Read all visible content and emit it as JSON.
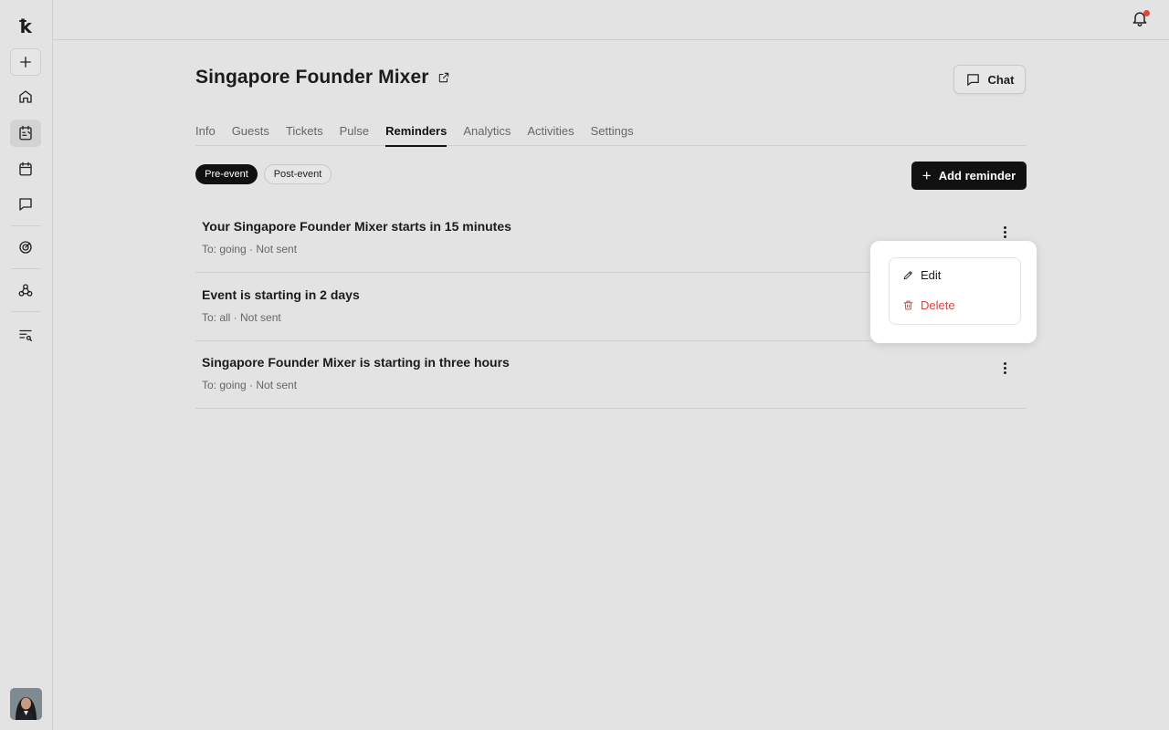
{
  "sidebar": {
    "logo": "ꝁ",
    "items": [
      {
        "name": "plus-icon"
      },
      {
        "name": "home-icon"
      },
      {
        "name": "event-icon"
      },
      {
        "name": "calendar-icon"
      },
      {
        "name": "chat-icon"
      },
      {
        "name": "analytics-icon"
      },
      {
        "name": "webhook-icon"
      },
      {
        "name": "search-list-icon"
      }
    ]
  },
  "header": {
    "notification_dot_color": "#e0483e"
  },
  "event": {
    "title": "Singapore Founder Mixer",
    "chat_label": "Chat"
  },
  "tabs": [
    {
      "label": "Info"
    },
    {
      "label": "Guests"
    },
    {
      "label": "Tickets"
    },
    {
      "label": "Pulse"
    },
    {
      "label": "Reminders",
      "active": true
    },
    {
      "label": "Analytics"
    },
    {
      "label": "Activities"
    },
    {
      "label": "Settings"
    }
  ],
  "filters": {
    "pre_event": "Pre-event",
    "post_event": "Post-event",
    "selected": "Pre-event"
  },
  "add_reminder_label": "Add reminder",
  "reminders": [
    {
      "title": "Your Singapore Founder Mixer starts in 15 minutes",
      "subtitle": "To: going · Not sent"
    },
    {
      "title": "Event is starting in 2 days",
      "subtitle": "To: all · Not sent"
    },
    {
      "title": "Singapore Founder Mixer is starting in three hours",
      "subtitle": "To: going · Not sent"
    }
  ],
  "context_menu": {
    "edit_label": "Edit",
    "delete_label": "Delete",
    "delete_color": "#d9453b"
  }
}
